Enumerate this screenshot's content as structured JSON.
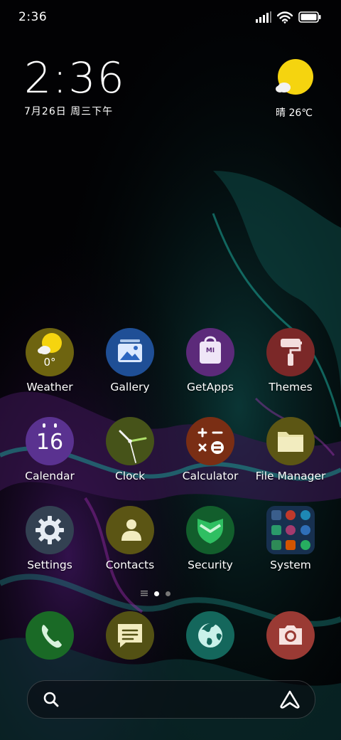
{
  "status_bar": {
    "time": "2:36"
  },
  "clock_widget": {
    "time": "2:36",
    "date": "7月26日 周三下午"
  },
  "weather_widget": {
    "text": "晴 26℃"
  },
  "apps": {
    "weather": {
      "label": "Weather",
      "temp": "0°"
    },
    "gallery": {
      "label": "Gallery"
    },
    "getapps": {
      "label": "GetApps",
      "logo": "MI"
    },
    "themes": {
      "label": "Themes"
    },
    "calendar": {
      "label": "Calendar",
      "day": "16"
    },
    "clock": {
      "label": "Clock"
    },
    "calculator": {
      "label": "Calculator"
    },
    "file_manager": {
      "label": "File Manager"
    },
    "settings": {
      "label": "Settings"
    },
    "contacts": {
      "label": "Contacts"
    },
    "security": {
      "label": "Security"
    },
    "system": {
      "label": "System"
    }
  },
  "dock": [
    {
      "name": "phone",
      "icon": "phone-icon"
    },
    {
      "name": "messages",
      "icon": "message-icon"
    },
    {
      "name": "browser",
      "icon": "globe-icon"
    },
    {
      "name": "camera",
      "icon": "camera-icon"
    }
  ],
  "search_bar": {
    "left_icon": "search-icon",
    "right_icon": "assistant-icon"
  },
  "page_indicator": {
    "pages": 2,
    "active": 1
  },
  "colors": {
    "weather": "#6e6410",
    "gallery": "#1f4f96",
    "getapps": "#5c2a7a",
    "themes": "#7b2828",
    "calendar": "#5a3290",
    "clock": "#465319",
    "calculator": "#7a2e14",
    "file_manager": "#5c5614",
    "settings": "#334152",
    "contacts": "#5b5514",
    "security": "#125e2c",
    "system": "#17304f",
    "phone": "#1a6a26",
    "messages": "#535114",
    "browser": "#14675c",
    "camera": "#9a3a34"
  }
}
